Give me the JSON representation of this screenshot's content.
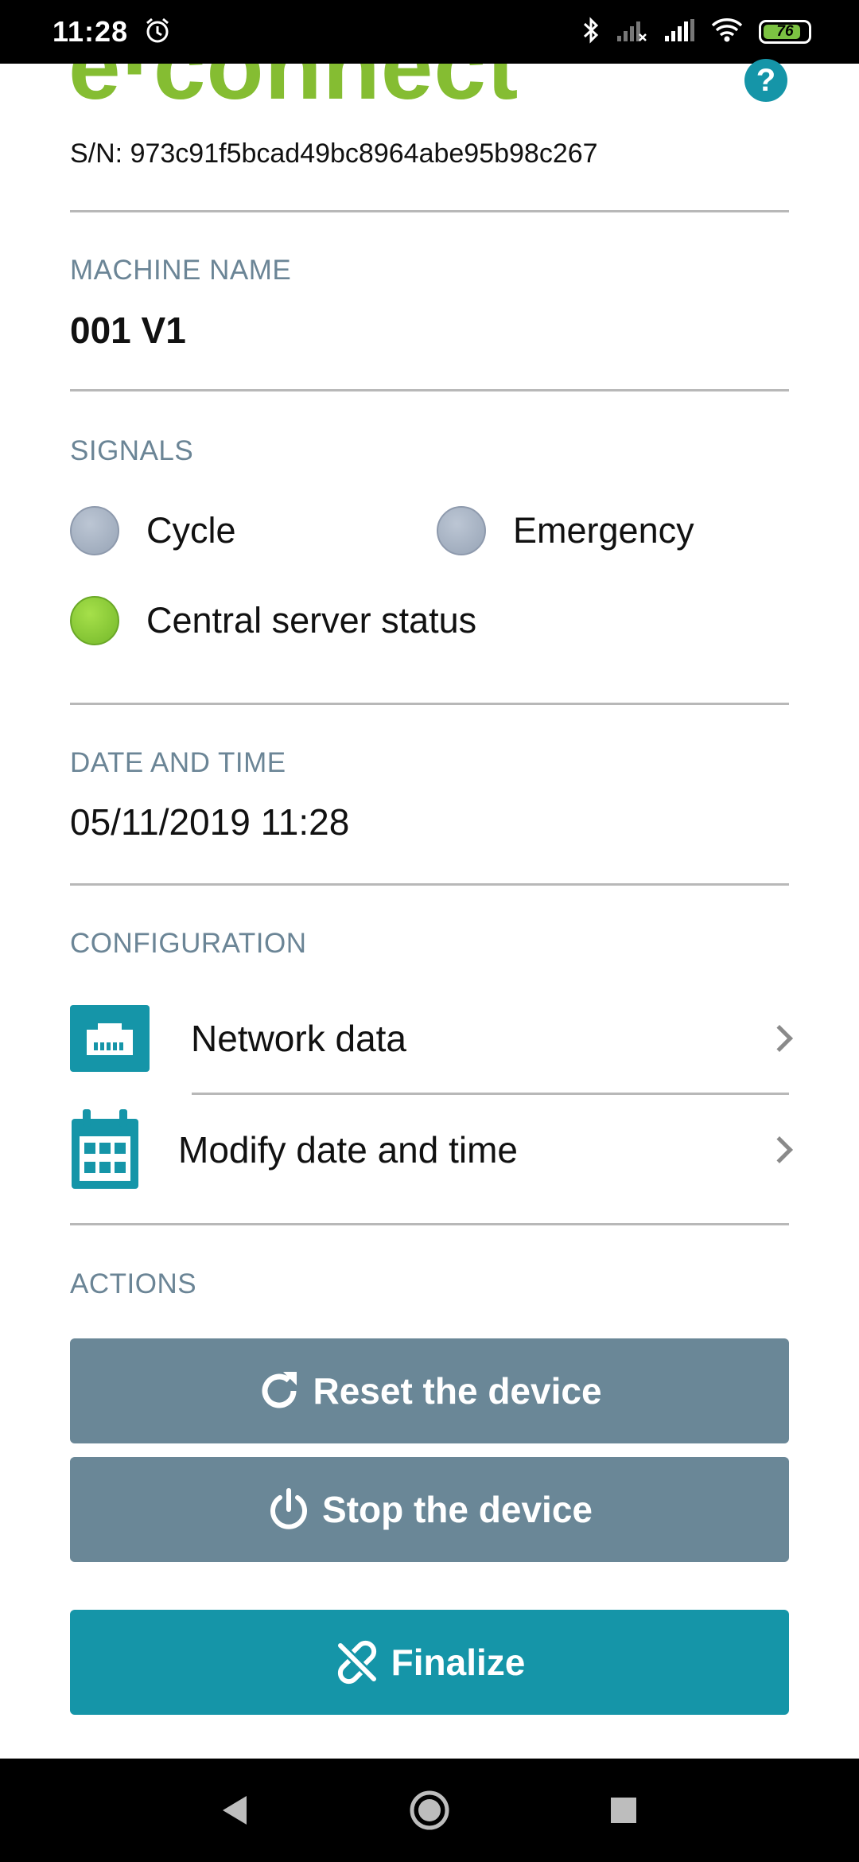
{
  "status_bar": {
    "time": "11:28",
    "battery": "76",
    "icons": [
      "alarm-icon",
      "bluetooth-icon",
      "signal-icon",
      "signal-icon",
      "wifi-icon",
      "battery-icon"
    ]
  },
  "header": {
    "logo": "e·connect",
    "serial": "S/N: 973c91f5bcad49bc8964abe95b98c267",
    "help_icon": "?"
  },
  "machine": {
    "label": "MACHINE NAME",
    "value": "001 V1"
  },
  "signals": {
    "label": "SIGNALS",
    "items": [
      {
        "label": "Cycle",
        "state": "inactive"
      },
      {
        "label": "Emergency",
        "state": "inactive"
      },
      {
        "label": "Central server status",
        "state": "active"
      }
    ]
  },
  "datetime": {
    "label": "DATE AND TIME",
    "value": "05/11/2019 11:28"
  },
  "configuration": {
    "label": "CONFIGURATION",
    "items": [
      {
        "label": "Network data",
        "icon": "ethernet-icon"
      },
      {
        "label": "Modify date and time",
        "icon": "calendar-icon"
      }
    ]
  },
  "actions": {
    "label": "ACTIONS",
    "reset": "Reset the device",
    "stop": "Stop the device",
    "finalize": "Finalize"
  },
  "colors": {
    "brand_green": "#85bd32",
    "teal": "#1595a8",
    "slate": "#6a8797",
    "label_grey": "#6b8596"
  }
}
